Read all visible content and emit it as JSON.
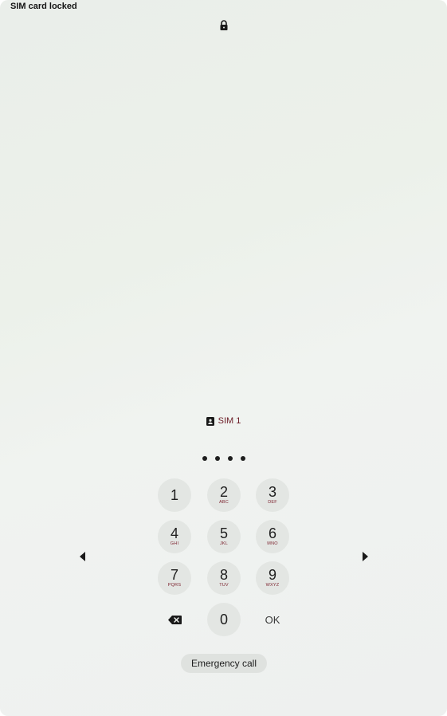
{
  "status": {
    "title": "SIM card locked"
  },
  "lockscreen": {
    "sim_label": "SIM 1",
    "pin_dots_count": 4
  },
  "keypad": {
    "keys": [
      {
        "digit": "1",
        "letters": ""
      },
      {
        "digit": "2",
        "letters": "ABC"
      },
      {
        "digit": "3",
        "letters": "DEF"
      },
      {
        "digit": "4",
        "letters": "GHI"
      },
      {
        "digit": "5",
        "letters": "JKL"
      },
      {
        "digit": "6",
        "letters": "MNO"
      },
      {
        "digit": "7",
        "letters": "PQRS"
      },
      {
        "digit": "8",
        "letters": "TUV"
      },
      {
        "digit": "9",
        "letters": "WXYZ"
      },
      {
        "digit": "0",
        "letters": ""
      }
    ],
    "ok_label": "OK",
    "delete_icon": "backspace-icon"
  },
  "emergency": {
    "label": "Emergency call"
  },
  "icons": {
    "lock": "lock-icon",
    "sim": "sim-card-icon",
    "prev": "arrow-left-icon",
    "next": "arrow-right-icon"
  }
}
